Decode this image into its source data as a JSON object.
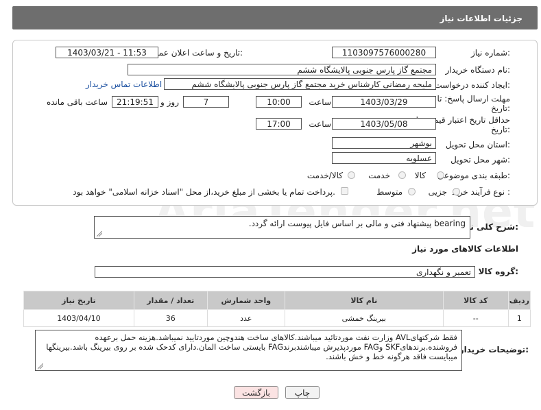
{
  "header": {
    "title": "جزئیات اطلاعات نیاز"
  },
  "form": {
    "need_number_label": "شماره نیاز:",
    "need_number": "1103097576000280",
    "announce_label": "تاریخ و ساعت اعلان عمومی:",
    "announce_value": "1403/03/21 - 11:53",
    "buyer_org_label": "نام دستگاه خریدار:",
    "buyer_org": "مجتمع گاز پارس جنوبی  پالایشگاه ششم",
    "creator_label": "ایجاد کننده درخواست:",
    "creator": "ملیحه رمضانی کارشناس خرید مجتمع گاز پارس جنوبی  پالایشگاه ششم",
    "buyer_contact_link": "اطلاعات تماس خریدار",
    "reply_deadline_label_1": "مهلت ارسال پاسخ: تا",
    "reply_deadline_label_2": "تاریخ:",
    "reply_date": "1403/03/29",
    "time_label": "ساعت",
    "reply_time": "10:00",
    "days_value": "7",
    "days_label": "روز و",
    "remaining_time": "21:19:51",
    "remaining_label": "ساعت باقی مانده",
    "price_validity_label_1": "حداقل تاریخ اعتبار قیمت: تا",
    "price_validity_label_2": "تاریخ:",
    "validity_date": "1403/05/08",
    "validity_time": "17:00",
    "province_label": "استان محل تحویل:",
    "province": "بوشهر",
    "city_label": "شهر محل تحویل:",
    "city": "عسلویه",
    "category_label": "طبقه بندی موضوعی:",
    "category_options": [
      "کالا",
      "خدمت",
      "کالا/خدمت"
    ],
    "process_label": "نوع فرآیند خرید :",
    "process_options": [
      "جزیی",
      "متوسط"
    ],
    "payment_note": "پرداخت تمام یا بخشی از مبلغ خرید،از محل \"اسناد خزانه اسلامی\" خواهد بود."
  },
  "description": {
    "label": "شرح کلی نیاز:",
    "text": "bearing پیشنهاد فنی و مالی بر اساس فایل پیوست ارائه گردد."
  },
  "goods": {
    "section_title": "اطلاعات کالاهای مورد نیاز",
    "group_label": "گروه کالا:",
    "group_value": "تعمیر و نگهداری",
    "columns": [
      "ردیف",
      "کد کالا",
      "نام کالا",
      "واحد شمارش",
      "تعداد / مقدار",
      "تاریخ نیاز"
    ],
    "rows": [
      {
        "row": "1",
        "code": "--",
        "name": "بیرینگ خمشی",
        "unit": "عدد",
        "qty": "36",
        "date": "1403/04/10"
      }
    ]
  },
  "buyer_notes": {
    "label": "توضیحات خریدار:",
    "text": "فقط شرکتهایAVL وزارت نفت موردتائید میباشند.کالاهای ساخت هندوچین موردتایید نمیباشد.هزینه حمل برعهده فروشنده.برندهایSKF وFAG موردپذیرش میباشندبرندFAG بایستی ساخت المان.دارای کدحک شده بر روی بیرینگ باشد.بیرینگها میبایست فاقد هرگونه خط و خش باشند."
  },
  "buttons": {
    "print": "چاپ",
    "back": "بازگشت"
  },
  "watermark": "AriaTender.net",
  "colors": {
    "header_bg": "#6e6e6e",
    "link": "#1a4fa0",
    "back_btn_bg": "#fbe3e3"
  }
}
